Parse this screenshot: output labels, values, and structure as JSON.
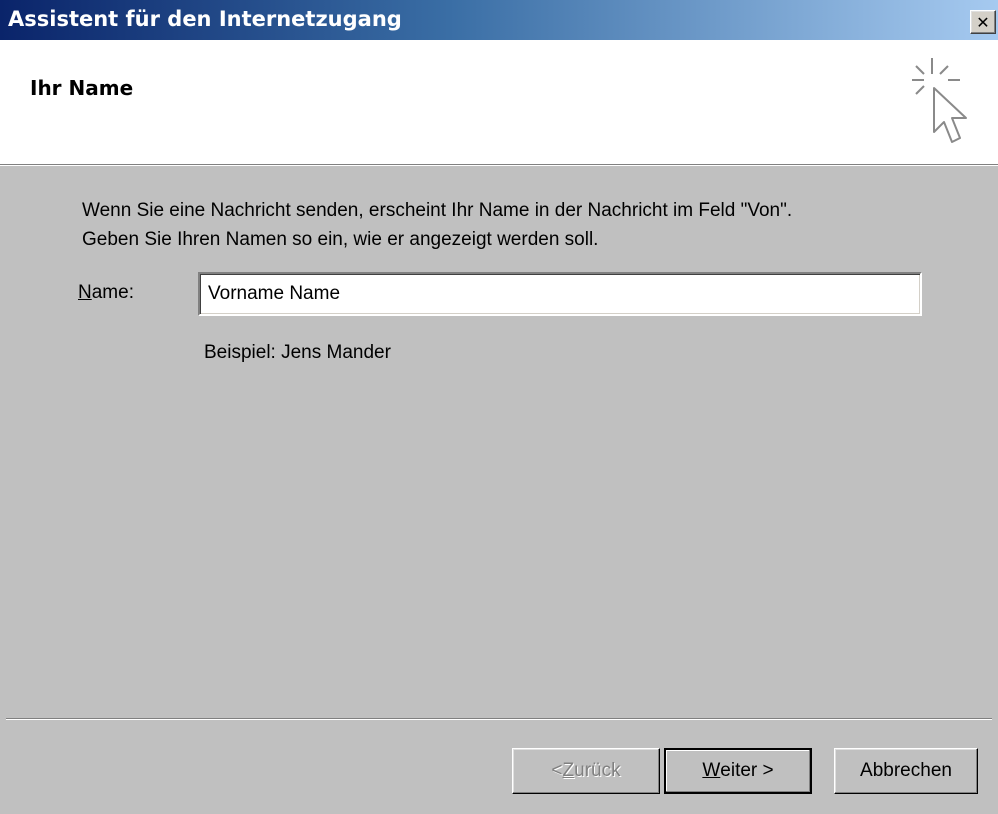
{
  "window": {
    "title": "Assistent für den Internetzugang",
    "close_glyph": "✕"
  },
  "header": {
    "title": "Ihr Name",
    "icon": "cursor-click-icon"
  },
  "body": {
    "description_line1": "Wenn Sie eine Nachricht senden, erscheint Ihr Name in der Nachricht im Feld \"Von\".",
    "description_line2": "Geben Sie Ihren Namen so ein, wie er angezeigt werden soll.",
    "name_label_mnemonic": "N",
    "name_label_rest": "ame:",
    "name_value": "Vorname Name",
    "example": "Beispiel: Jens Mander"
  },
  "buttons": {
    "back_prefix": "< ",
    "back_mnemonic": "Z",
    "back_rest": "urück",
    "next_mnemonic": "W",
    "next_rest": "eiter >",
    "cancel": "Abbrechen"
  },
  "colors": {
    "titlebar_start": "#0a246a",
    "titlebar_end": "#a6caf0",
    "dialog_face": "#c0c0c0"
  }
}
